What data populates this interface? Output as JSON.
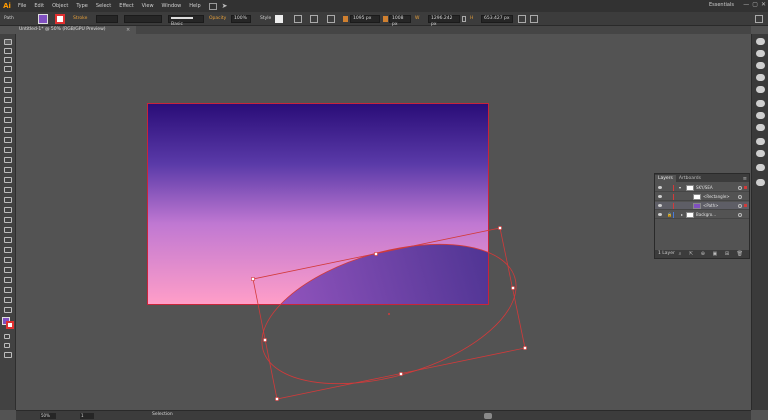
{
  "app": {
    "logo": "Ai",
    "workspace": "Essentials"
  },
  "menu": [
    "File",
    "Edit",
    "Object",
    "Type",
    "Select",
    "Effect",
    "View",
    "Window",
    "Help"
  ],
  "window_controls": [
    "—",
    "▢",
    "✕"
  ],
  "control": {
    "selection_type": "Path",
    "stroke_label": "Stroke",
    "brush_label": "Basic",
    "opacity_label": "Opacity",
    "opacity_value": "100%",
    "style_label": "Style",
    "x_value": "1095 px",
    "y_value": "1008 px",
    "w_label": "W",
    "w_value": "1296.242 px",
    "h_label": "H",
    "h_value": "653.427 px"
  },
  "document": {
    "tab_title": "Untitled-1* @ 50% (RGB/GPU Preview)",
    "close": "×"
  },
  "layers": {
    "tabs": [
      "Layers",
      "Artboards"
    ],
    "menu_icon": "≡",
    "rows": [
      {
        "name": "SKY/SEA"
      },
      {
        "name": "<Rectangle>"
      },
      {
        "name": "<Path>"
      },
      {
        "name": "Backgro..."
      }
    ],
    "footer": "1 Layer",
    "footer_icons": "⌕ ⇱ ⊕ ▣ ⊞ 🗑"
  },
  "status": {
    "zoom": "50%",
    "page": "1",
    "tool": "Selection"
  },
  "colors": {
    "fill": "#8050c0",
    "stroke": "#e03030",
    "artboard_border": "#c8253a",
    "selection": "#d23a3a",
    "gradient_top": "#2a0d78",
    "gradient_bottom": "#ff9ec8",
    "shape_light": "#9a58c2",
    "shape_dark": "#4a3290"
  },
  "icons": [
    "arrange-documents-icon",
    "send-icon",
    "selection-tool-icon",
    "direct-selection-tool-icon",
    "eye-icon",
    "locate-object-icon"
  ]
}
